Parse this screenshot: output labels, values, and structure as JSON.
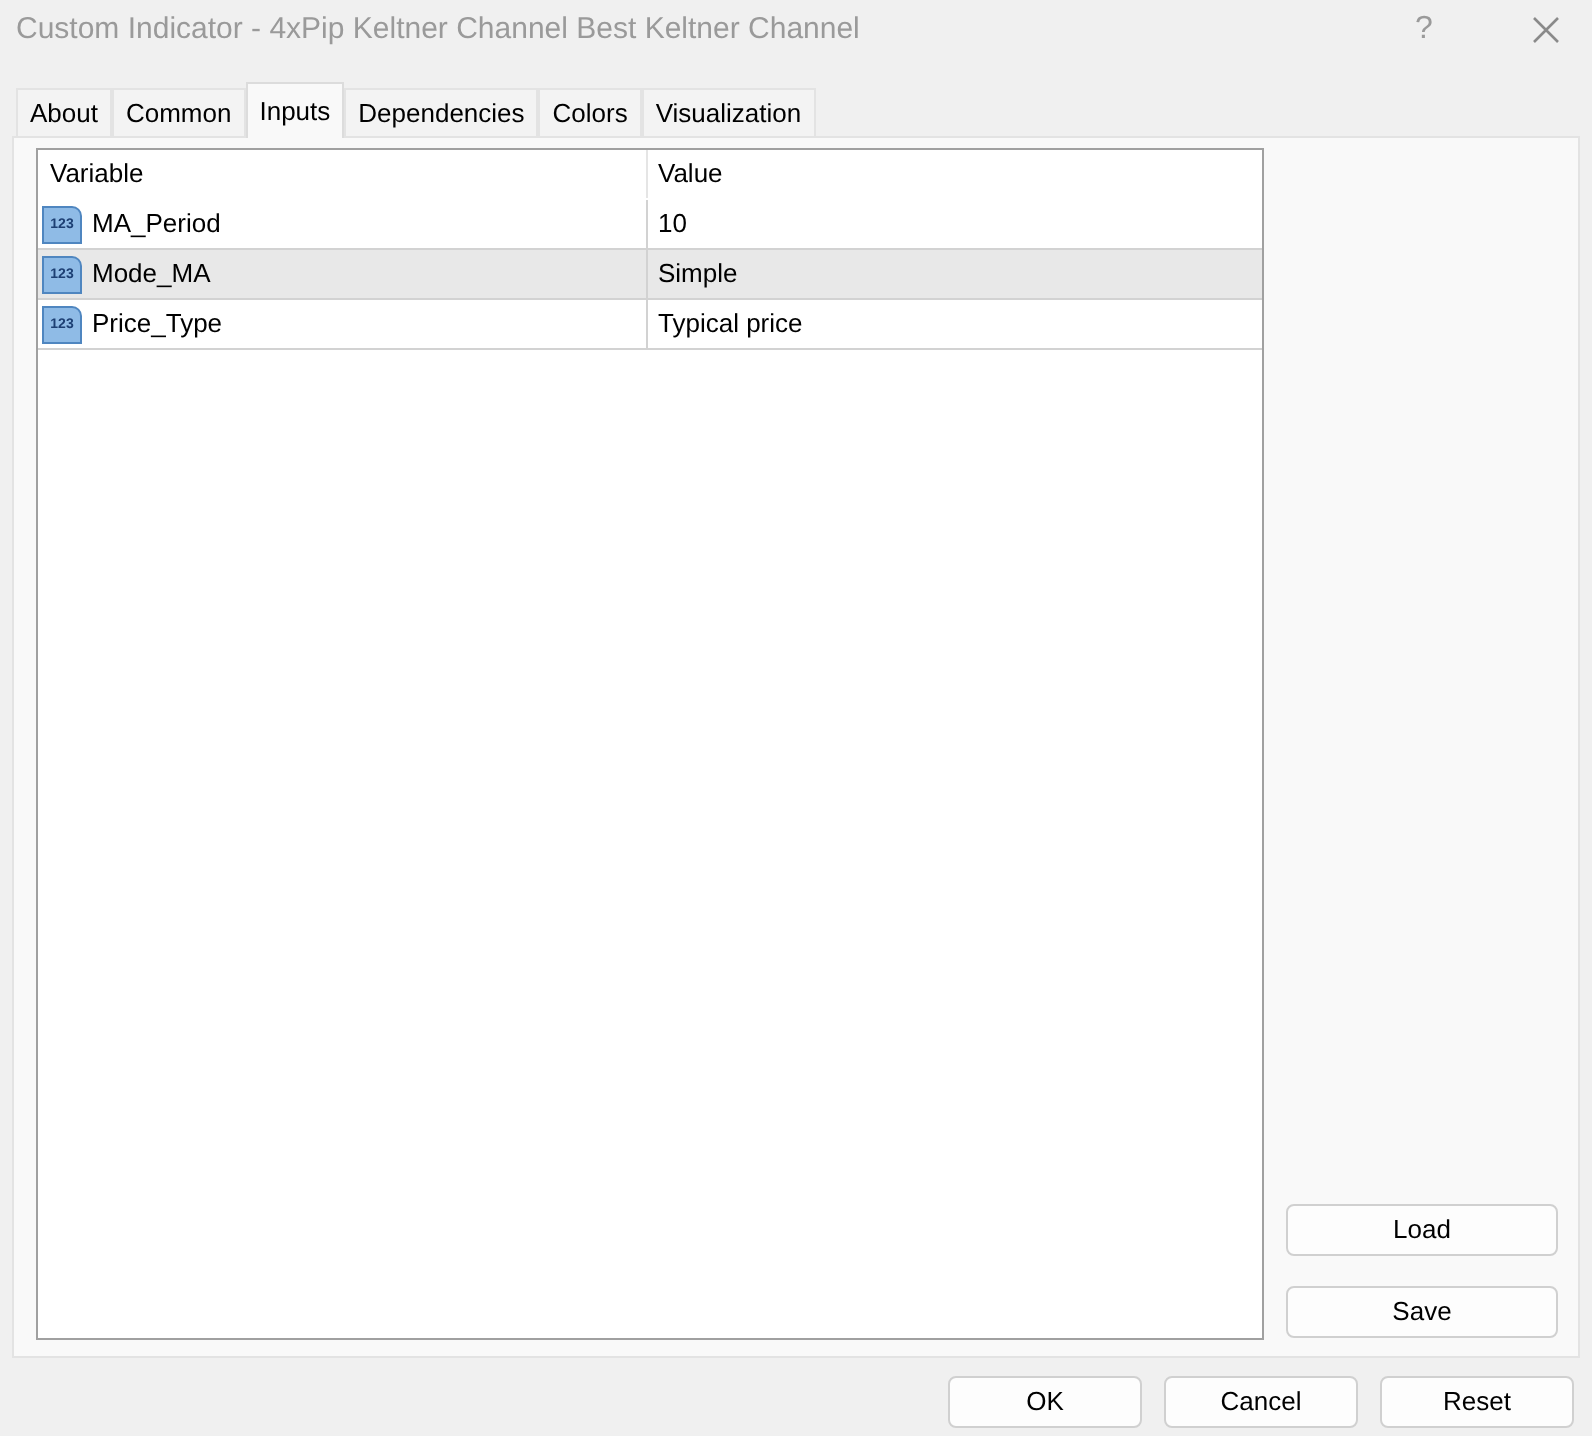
{
  "window": {
    "title": "Custom Indicator - 4xPip Keltner Channel Best Keltner Channel",
    "help": "?"
  },
  "tabs": [
    {
      "label": "About",
      "selected": false
    },
    {
      "label": "Common",
      "selected": false
    },
    {
      "label": "Inputs",
      "selected": true
    },
    {
      "label": "Dependencies",
      "selected": false
    },
    {
      "label": "Colors",
      "selected": false
    },
    {
      "label": "Visualization",
      "selected": false
    }
  ],
  "table": {
    "columns": [
      "Variable",
      "Value"
    ],
    "rows": [
      {
        "badge": "123",
        "variable": "MA_Period",
        "value": "10",
        "selected": false
      },
      {
        "badge": "123",
        "variable": "Mode_MA",
        "value": "Simple",
        "selected": true
      },
      {
        "badge": "123",
        "variable": "Price_Type",
        "value": "Typical price",
        "selected": false
      }
    ]
  },
  "side_buttons": [
    "Load",
    "Save"
  ],
  "footer_buttons": [
    "OK",
    "Cancel",
    "Reset"
  ]
}
